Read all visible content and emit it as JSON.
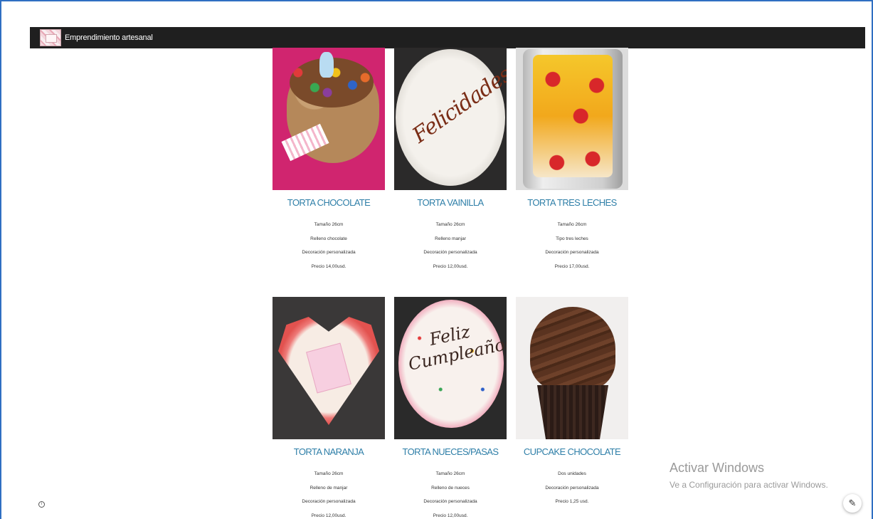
{
  "navbar": {
    "brand_name": "Emprendimiento artesanal",
    "background": "#1f1f1f"
  },
  "products": [
    {
      "title": "TORTA CHOCOLATE",
      "details": [
        "Tamaño 26cm",
        "Relleno chocolate",
        "Decoración personalizada",
        "Precio 14,00usd."
      ]
    },
    {
      "title": "TORTA VAINILLA",
      "details": [
        "Tamaño 26cm",
        "Relleno manjar",
        "Decoración personalizada",
        "Precio 12,00usd."
      ]
    },
    {
      "title": "TORTA TRES LECHES",
      "details": [
        "Tamaño 26cm",
        "Tipo tres leches",
        "Decoración personalizada",
        "Precio 17,00usd."
      ]
    },
    {
      "title": "TORTA NARANJA",
      "details": [
        "Tamaño 26cm",
        "Relleno de manjar",
        "Decoración personalizada",
        "Precio 12,00usd."
      ]
    },
    {
      "title": "TORTA NUECES/PASAS",
      "details": [
        "Tamaño 26cm",
        "Relleno de nueces",
        "Decoración personalizada",
        "Precio 12,00usd."
      ]
    },
    {
      "title": "CUPCAKE CHOCOLATE",
      "details": [
        "Dos unidades",
        "Decoración personalizada",
        "Precio 1,25 usd."
      ]
    }
  ],
  "photo_text": {
    "vanilla_cake": "Felicidades!",
    "birthday_cake": "Feliz Cumpleaños"
  },
  "watermark": {
    "line1": "Activar Windows",
    "line2": "Ve a Configuración para activar Windows."
  },
  "icons": {
    "info": "info-icon",
    "edit": "pencil-icon"
  },
  "colors": {
    "title_link": "#2f7fa8",
    "frame_border": "#2f6fc2"
  }
}
